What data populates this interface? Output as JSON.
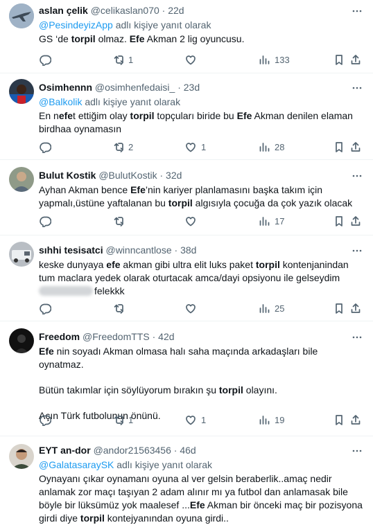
{
  "tweets": [
    {
      "name": "aslan çelik",
      "handle": "@celikaslan070",
      "time": "22d",
      "reply_prefix": "",
      "reply_mention": "@PesindeyizApp",
      "reply_suffix": "adlı kişiye yanıt olarak",
      "body": [
        "GS ‘de torpil olmaz. Efe Akman 2 lig oyuncusu."
      ],
      "replies": "",
      "retweets": "1",
      "likes": "",
      "views": "133",
      "avatar_icon": "jet-avatar"
    },
    {
      "name": "Osimhennn",
      "handle": "@osimhenfedaisi_",
      "time": "23d",
      "reply_mention": "@Balkolik",
      "reply_suffix": "adlı kişiye yanıt olarak",
      "body": [
        "En nefet ettiğim olay torpil topçuları biride bu Efe Akman denilen elaman birdhaa oynamasın"
      ],
      "replies": "",
      "retweets": "2",
      "likes": "1",
      "views": "28",
      "avatar_icon": "player-avatar"
    },
    {
      "name": "Bulut Kostik",
      "handle": "@BulutKostik",
      "time": "32d",
      "body": [
        "Ayhan Akman bence Efe’nin kariyer planlamasını başka takım için yapmalı,üstüne yaftalanan bu torpil algısıyla çocuğa da çok yazık olacak"
      ],
      "replies": "",
      "retweets": "",
      "likes": "",
      "views": "17",
      "avatar_icon": "person-avatar"
    },
    {
      "name": "sıhhi tesisatci",
      "handle": "@winncantlose",
      "time": "38d",
      "body": [
        "keske dunyaya efe akman gibi ultra elit luks paket torpil kontenjanindan tum maclara yedek olarak oturtacak amca/dayi opsiyonu ile gelseydim",
        "felekkk"
      ],
      "replies": "",
      "retweets": "",
      "likes": "",
      "views": "25",
      "avatar_icon": "van-avatar"
    },
    {
      "name": "Freedom",
      "handle": "@FreedomTTS",
      "time": "42d",
      "body": [
        "Efe nin soyadı Akman olmasa halı saha maçında arkadaşları bile oynatmaz.",
        "Bütün takımlar için söylüyorum bırakın şu torpil olayını.",
        "Açın Türk futbolunun önünü."
      ],
      "replies": "",
      "retweets": "1",
      "likes": "1",
      "views": "19",
      "avatar_icon": "dark-avatar"
    },
    {
      "name": "EYT an-dor",
      "handle": "@andor21563456",
      "time": "46d",
      "reply_mention": "@GalatasaraySK",
      "reply_suffix": "adlı kişiye yanıt olarak",
      "body": [
        "Oynayanı çıkar oynamanı oyuna al ver gelsin beraberlik..amaç nedir anlamak zor maçı taşıyan 2 adam alınır mı ya futbol dan anlamasak bile böyle bir lüksümüz yok maalesef ...Efe Akman bir önceki maç bir pozisyona girdi diye torpil kontejyanından oyuna girdi.."
      ],
      "avatar_icon": "man-avatar"
    }
  ],
  "colors": {
    "text": "#0f1419",
    "muted": "#536471",
    "link": "#1d9bf0",
    "border": "#eff3f4"
  }
}
